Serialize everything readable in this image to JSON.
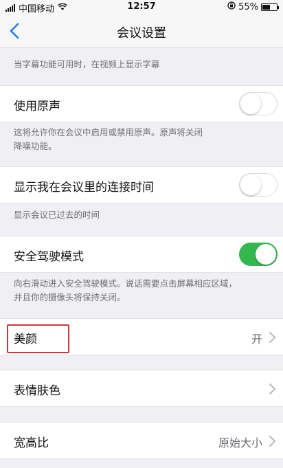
{
  "status_bar": {
    "carrier": "中国移动",
    "time": "12:57",
    "battery": "55%",
    "battery_level": 0.55
  },
  "nav": {
    "title": "会议设置",
    "back_icon": "chevron-left-icon"
  },
  "settings": {
    "captions_desc": "当字幕功能可用时，在视频上显示字幕",
    "original_sound": {
      "label": "使用原声",
      "enabled": false,
      "desc_line1": "这将允许你在会议中启用或禁用原声。原声将关闭",
      "desc_line2": "降噪功能。"
    },
    "connection_time": {
      "label": "显示我在会议里的连接时间",
      "enabled": false,
      "desc": "显示会议已过去的时间"
    },
    "safe_driving": {
      "label": "安全驾驶模式",
      "enabled": true,
      "desc_line1": "向右滑动进入安全驾驶模式。说话需要点击屏幕相应区域，",
      "desc_line2": "并且你的摄像头将保持关闭。"
    },
    "beauty": {
      "label": "美颜",
      "value": "开"
    },
    "skin_tone": {
      "label": "表情肤色"
    },
    "aspect_ratio": {
      "label": "宽高比",
      "value": "原始大小"
    }
  },
  "colors": {
    "toggle_on": "#34b74f",
    "highlight": "#d0343c"
  }
}
